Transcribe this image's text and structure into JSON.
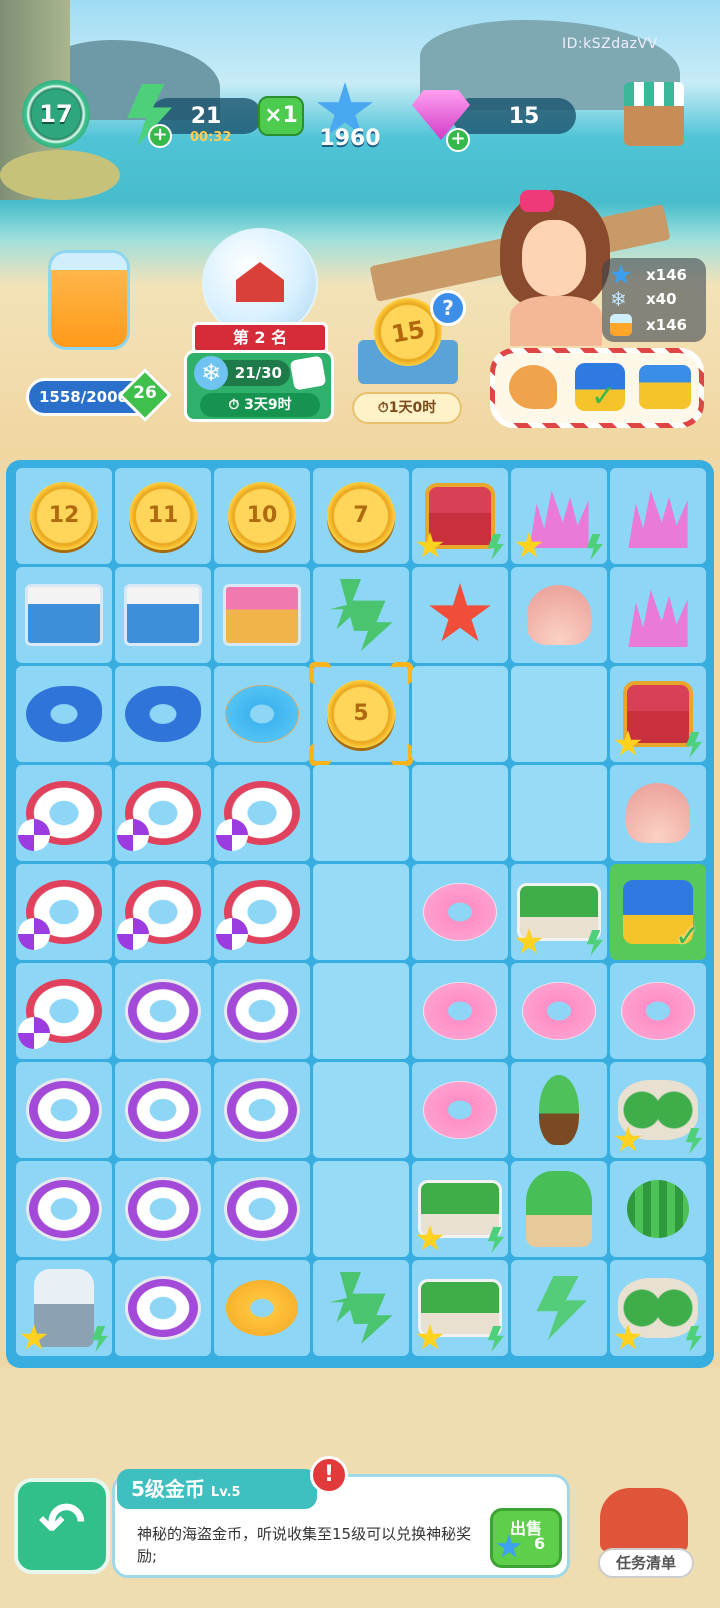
{
  "player": {
    "level": "17",
    "id": "ID:kSZdazVV"
  },
  "energy": {
    "value": "21",
    "timer": "00:32",
    "multiplier": "×1"
  },
  "stars": {
    "value": "1960"
  },
  "gems": {
    "value": "15"
  },
  "jar": {
    "progress": "1558/2000",
    "level": "26"
  },
  "event": {
    "rank": "第 2 名",
    "progress": "21/30",
    "time": "3天9时"
  },
  "coin_event": {
    "value": "15",
    "help": "?",
    "time": "1天0时"
  },
  "resources": [
    {
      "icon": "blue-star-icon",
      "value": "x146"
    },
    {
      "icon": "snowflake-icon",
      "value": "x40"
    },
    {
      "icon": "juice-icon",
      "value": "x146"
    }
  ],
  "order_items": [
    "conch-shell-icon",
    "watering-can-icon",
    "toy-truck-icon"
  ],
  "board": [
    [
      {
        "t": "coin",
        "v": "12"
      },
      {
        "t": "coin",
        "v": "11"
      },
      {
        "t": "coin",
        "v": "10"
      },
      {
        "t": "coin",
        "v": "7"
      },
      {
        "t": "chest",
        "star": true
      },
      {
        "t": "coral",
        "star": true
      },
      {
        "t": "coral-star"
      }
    ],
    [
      {
        "t": "cart"
      },
      {
        "t": "cart"
      },
      {
        "t": "cart-pink"
      },
      {
        "t": "leaf-multi"
      },
      {
        "t": "starfish"
      },
      {
        "t": "shell"
      },
      {
        "t": "coral-shell"
      }
    ],
    [
      {
        "t": "whale"
      },
      {
        "t": "whale"
      },
      {
        "t": "donut-blue"
      },
      {
        "t": "coin",
        "v": "5",
        "selected": true
      },
      {
        "t": "empty"
      },
      {
        "t": "empty"
      },
      {
        "t": "chest",
        "star": true
      }
    ],
    [
      {
        "t": "ring-ball"
      },
      {
        "t": "ring-ball"
      },
      {
        "t": "ring-ball"
      },
      {
        "t": "empty"
      },
      {
        "t": "empty"
      },
      {
        "t": "empty"
      },
      {
        "t": "shell-pink"
      }
    ],
    [
      {
        "t": "ring-ball"
      },
      {
        "t": "ring-ball"
      },
      {
        "t": "ring-ball"
      },
      {
        "t": "empty"
      },
      {
        "t": "donut"
      },
      {
        "t": "tray",
        "star": true
      },
      {
        "t": "can",
        "done": true
      }
    ],
    [
      {
        "t": "ring-ball"
      },
      {
        "t": "ring-purple"
      },
      {
        "t": "ring-purple"
      },
      {
        "t": "empty"
      },
      {
        "t": "donut"
      },
      {
        "t": "donut"
      },
      {
        "t": "donut"
      }
    ],
    [
      {
        "t": "ring-purple"
      },
      {
        "t": "ring-purple"
      },
      {
        "t": "ring-purple"
      },
      {
        "t": "empty"
      },
      {
        "t": "donut"
      },
      {
        "t": "sprout"
      },
      {
        "t": "melons",
        "star": true
      }
    ],
    [
      {
        "t": "ring-purple"
      },
      {
        "t": "ring-purple"
      },
      {
        "t": "ring-purple"
      },
      {
        "t": "empty"
      },
      {
        "t": "tray",
        "star": true
      },
      {
        "t": "plant"
      },
      {
        "t": "melon"
      }
    ],
    [
      {
        "t": "juicer",
        "star": true
      },
      {
        "t": "ring-purple"
      },
      {
        "t": "duck"
      },
      {
        "t": "leaf-multi"
      },
      {
        "t": "tray",
        "star": true
      },
      {
        "t": "leaf"
      },
      {
        "t": "melons",
        "star": true
      }
    ]
  ],
  "info": {
    "title": "5级金币",
    "level": "Lv.5",
    "desc": "神秘的海盗金币，听说收集至15级可以兑换神秘奖励;",
    "alert": "!"
  },
  "sell": {
    "label": "出售",
    "value": "6"
  },
  "tasks": {
    "label": "任务清单"
  },
  "back_label": "↶"
}
